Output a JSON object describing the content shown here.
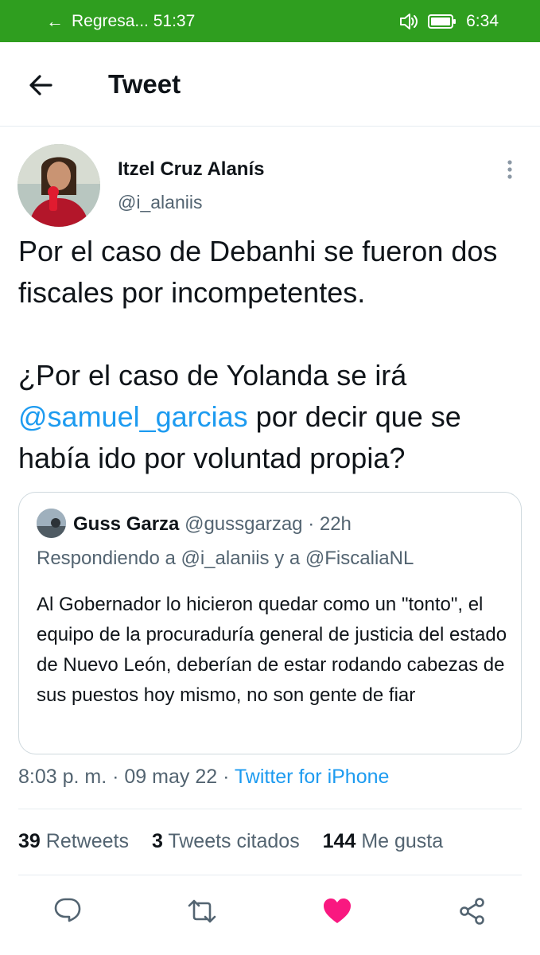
{
  "status_bar": {
    "back_label": "Regresa... 51:37",
    "time": "6:34"
  },
  "header": {
    "title": "Tweet"
  },
  "tweet": {
    "author_name": "Itzel Cruz Alanís",
    "author_handle": "@i_alaniis",
    "text_para1": "Por el caso de Debanhi se fueron dos fiscales por incompetentes.",
    "text_para2_before": "¿Por el caso de Yolanda se irá ",
    "text_mention": "@samuel_garcias",
    "text_para2_after": " por decir que se había ido por voluntad propia?",
    "quote": {
      "author_name": "Guss Garza",
      "meta": "@gussgarzag · 22h",
      "replying_to": "Respondiendo a @i_alaniis y a @FiscaliaNL",
      "text": "Al Gobernador lo hicieron quedar como un \"tonto\", el equipo de la procuraduría general de justicia del estado de Nuevo León, deberían de estar rodando cabezas de sus puestos hoy mismo, no son gente de fiar"
    },
    "timestamp": "8:03 p. m. · 09 may 22 · ",
    "source": "Twitter for iPhone",
    "stats": {
      "retweets_count": "39",
      "retweets_label": "Retweets",
      "quotes_count": "3",
      "quotes_label": "Tweets citados",
      "likes_count": "144",
      "likes_label": "Me gusta"
    }
  },
  "icons": {
    "back": "arrow-left-icon",
    "more": "more-vertical-icon",
    "reply": "reply-icon",
    "retweet": "retweet-icon",
    "like": "heart-icon",
    "share": "share-icon",
    "volume": "volume-icon",
    "battery": "battery-icon"
  },
  "colors": {
    "status_bar": "#2f9e1f",
    "link": "#1d9bf0",
    "like": "#f91880",
    "secondary_text": "#536471"
  }
}
